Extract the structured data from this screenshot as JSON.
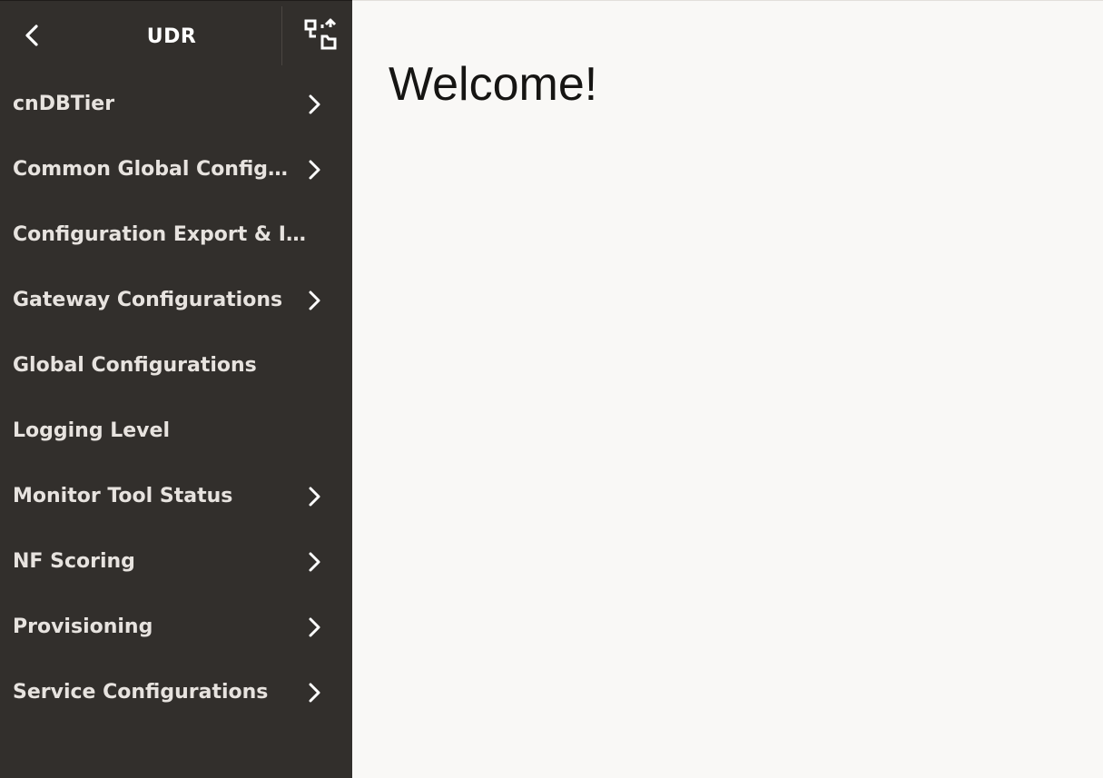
{
  "sidebar": {
    "title": "UDR",
    "back_icon": "chevron-left-icon",
    "switch_icon": "switch-view-icon",
    "background_color": "#322f2c",
    "items": [
      {
        "label": "cnDBTier",
        "has_children": true
      },
      {
        "label": "Common Global Configurations",
        "has_children": true
      },
      {
        "label": "Configuration Export & Import",
        "has_children": false
      },
      {
        "label": "Gateway Configurations",
        "has_children": true
      },
      {
        "label": "Global Configurations",
        "has_children": false
      },
      {
        "label": "Logging Level",
        "has_children": false
      },
      {
        "label": "Monitor Tool Status",
        "has_children": true
      },
      {
        "label": "NF Scoring",
        "has_children": true
      },
      {
        "label": "Provisioning",
        "has_children": true
      },
      {
        "label": "Service Configurations",
        "has_children": true
      }
    ]
  },
  "main": {
    "heading": "Welcome!",
    "background_color": "#f9f8f6"
  }
}
